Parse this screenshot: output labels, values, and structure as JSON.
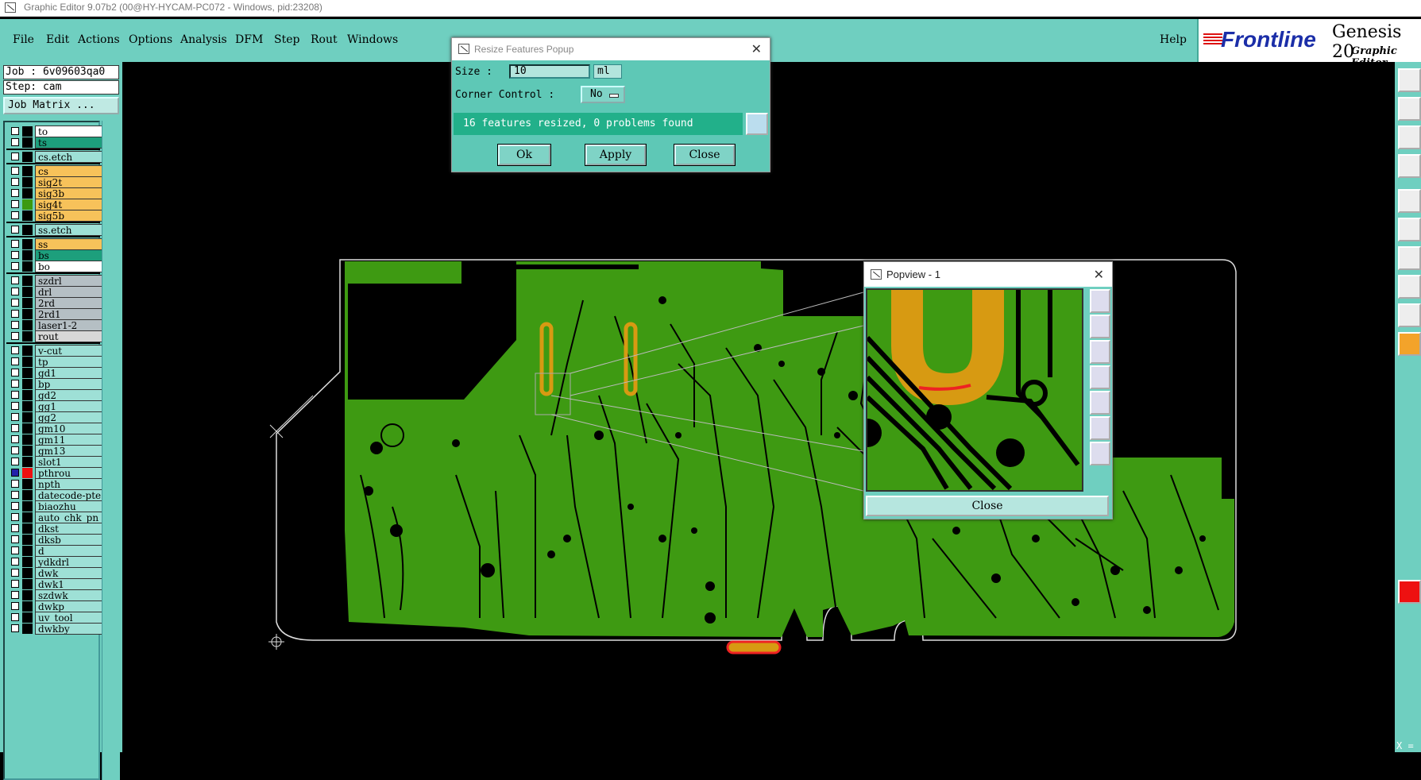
{
  "window": {
    "title": "Graphic Editor 9.07b2 (00@HY-HYCAM-PC072 - Windows, pid:23208)"
  },
  "menu": {
    "items": [
      "File",
      "Edit",
      "Actions",
      "Options",
      "Analysis",
      "DFM",
      "Step",
      "Rout",
      "Windows"
    ],
    "help": "Help"
  },
  "logo": {
    "brand": "Frontline",
    "product": "Genesis 20",
    "subtitle": "Graphic Editor"
  },
  "job": {
    "job_label": "Job : 6v09603qa0",
    "step_label": "Step: cam",
    "matrix_button": "Job Matrix ..."
  },
  "layers": [
    {
      "name": "to",
      "color": "#ffffff",
      "group": 1
    },
    {
      "name": "ts",
      "color": "#1d9f7c",
      "group": 1
    },
    {
      "name": "cs.etch",
      "color": "#9ee0d6",
      "group": 2
    },
    {
      "name": "cs",
      "color": "#f7c25a",
      "group": 3
    },
    {
      "name": "sig2t",
      "color": "#f7c25a",
      "group": 3
    },
    {
      "name": "sig3b",
      "color": "#f7c25a",
      "group": 3
    },
    {
      "name": "sig4t",
      "color": "#f7c25a",
      "group": 3,
      "swatch": "#3c9a10"
    },
    {
      "name": "sig5b",
      "color": "#f7c25a",
      "group": 3
    },
    {
      "name": "ss.etch",
      "color": "#9ee0d6",
      "group": 4
    },
    {
      "name": "ss",
      "color": "#f7c25a",
      "group": 5
    },
    {
      "name": "bs",
      "color": "#1d9f7c",
      "group": 5
    },
    {
      "name": "bo",
      "color": "#ffffff",
      "group": 5
    },
    {
      "name": "szdrl",
      "color": "#b5bfc4",
      "group": 6
    },
    {
      "name": "drl",
      "color": "#b5bfc4",
      "group": 6
    },
    {
      "name": "2rd",
      "color": "#b5bfc4",
      "group": 6
    },
    {
      "name": "2rd1",
      "color": "#b5bfc4",
      "group": 6
    },
    {
      "name": "laser1-2",
      "color": "#b5bfc4",
      "group": 6
    },
    {
      "name": "rout",
      "color": "#d7d7d7",
      "group": 6
    },
    {
      "name": "v-cut",
      "color": "#9ee0d6",
      "group": 7
    },
    {
      "name": "tp",
      "color": "#9ee0d6",
      "group": 7
    },
    {
      "name": "gd1",
      "color": "#9ee0d6",
      "group": 7
    },
    {
      "name": "bp",
      "color": "#9ee0d6",
      "group": 7
    },
    {
      "name": "gd2",
      "color": "#9ee0d6",
      "group": 7
    },
    {
      "name": "gg1",
      "color": "#9ee0d6",
      "group": 7
    },
    {
      "name": "gg2",
      "color": "#9ee0d6",
      "group": 7
    },
    {
      "name": "gm10",
      "color": "#9ee0d6",
      "group": 7
    },
    {
      "name": "gm11",
      "color": "#9ee0d6",
      "group": 7
    },
    {
      "name": "gm13",
      "color": "#9ee0d6",
      "group": 7
    },
    {
      "name": "slot1",
      "color": "#9ee0d6",
      "group": 7
    },
    {
      "name": "pthrou",
      "color": "#9ee0d6",
      "group": 7,
      "swatch": "#ee1111",
      "checked": true
    },
    {
      "name": "npth",
      "color": "#9ee0d6",
      "group": 7
    },
    {
      "name": "datecode-pte",
      "color": "#9ee0d6",
      "group": 7
    },
    {
      "name": "biaozhu",
      "color": "#9ee0d6",
      "group": 7
    },
    {
      "name": "auto_chk_pn",
      "color": "#9ee0d6",
      "group": 7
    },
    {
      "name": "dkst",
      "color": "#9ee0d6",
      "group": 7
    },
    {
      "name": "dksb",
      "color": "#9ee0d6",
      "group": 7
    },
    {
      "name": "d",
      "color": "#9ee0d6",
      "group": 7
    },
    {
      "name": "ydkdrl",
      "color": "#9ee0d6",
      "group": 7
    },
    {
      "name": "dwk",
      "color": "#9ee0d6",
      "group": 7
    },
    {
      "name": "dwk1",
      "color": "#9ee0d6",
      "group": 7
    },
    {
      "name": "szdwk",
      "color": "#9ee0d6",
      "group": 7
    },
    {
      "name": "dwkp",
      "color": "#9ee0d6",
      "group": 7
    },
    {
      "name": "uv_tool",
      "color": "#9ee0d6",
      "group": 7
    },
    {
      "name": "dwkby",
      "color": "#9ee0d6",
      "group": 7
    }
  ],
  "resize_popup": {
    "title": "Resize Features Popup",
    "size_label": "Size :",
    "size_value": "10",
    "size_unit": "ml",
    "corner_label": "Corner Control :",
    "corner_value": "No",
    "status": "16 features resized, 0 problems found",
    "ok": "Ok",
    "apply": "Apply",
    "close": "Close"
  },
  "popview": {
    "title": "Popview - 1",
    "close": "Close"
  },
  "coords": {
    "x_label": "X ="
  },
  "colors": {
    "panel": "#6fcfc0",
    "board": "#3e9a12",
    "highlight": "#d79a12",
    "selected": "#ee2222"
  }
}
